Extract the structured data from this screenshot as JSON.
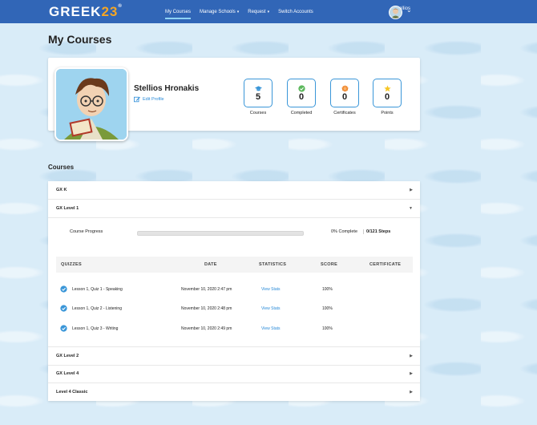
{
  "header": {
    "logo_text": "GREEK",
    "logo_num": "23",
    "logo_reg": "®",
    "nav": [
      {
        "label": "My Courses"
      },
      {
        "label": "Manage Schools"
      },
      {
        "label": "Request"
      },
      {
        "label": "Switch Accounts"
      }
    ],
    "user_name": "StelIios"
  },
  "page_title": "My Courses",
  "profile": {
    "name": "Stellios Hronakis",
    "edit_label": "Edit Profile",
    "stats": [
      {
        "value": "5",
        "label": "Courses",
        "icon": "graduation-cap-icon",
        "color": "#3a96d8"
      },
      {
        "value": "0",
        "label": "Completed",
        "icon": "check-circle-icon",
        "color": "#5cb85c"
      },
      {
        "value": "0",
        "label": "Certificates",
        "icon": "badge-icon",
        "color": "#f0862b"
      },
      {
        "value": "0",
        "label": "Points",
        "icon": "star-icon",
        "color": "#f6c623"
      }
    ]
  },
  "courses_heading": "Courses",
  "courses": [
    {
      "title": "GX K",
      "expanded": false
    },
    {
      "title": "GX Level 1",
      "expanded": true
    },
    {
      "title": "GX Level 2",
      "expanded": false
    },
    {
      "title": "GX Level 4",
      "expanded": false
    },
    {
      "title": "Level 4 Classic",
      "expanded": false
    }
  ],
  "progress": {
    "label": "Course Progress",
    "percent_label": "0% Complete",
    "steps_label": "0/121 Steps",
    "fraction": 0.0
  },
  "quiz_table": {
    "columns": [
      "QUIZZES",
      "DATE",
      "STATISTICS",
      "SCORE",
      "CERTIFICATE"
    ],
    "rows": [
      {
        "quiz": "Lesson 1, Quiz 1 - Speaking",
        "date": "November 10, 2020 2:47 pm",
        "stats": "View Stats",
        "score": "100%"
      },
      {
        "quiz": "Lesson 1, Quiz 2 - Listening",
        "date": "November 10, 2020 2:48 pm",
        "stats": "View Stats",
        "score": "100%"
      },
      {
        "quiz": "Lesson 1, Quiz 3 - Writing",
        "date": "November 10, 2020 2:49 pm",
        "stats": "View Stats",
        "score": "100%"
      }
    ]
  },
  "colors": {
    "brand": "#3166b7",
    "accent": "#3a96d8",
    "logo_accent": "#f6a623"
  }
}
